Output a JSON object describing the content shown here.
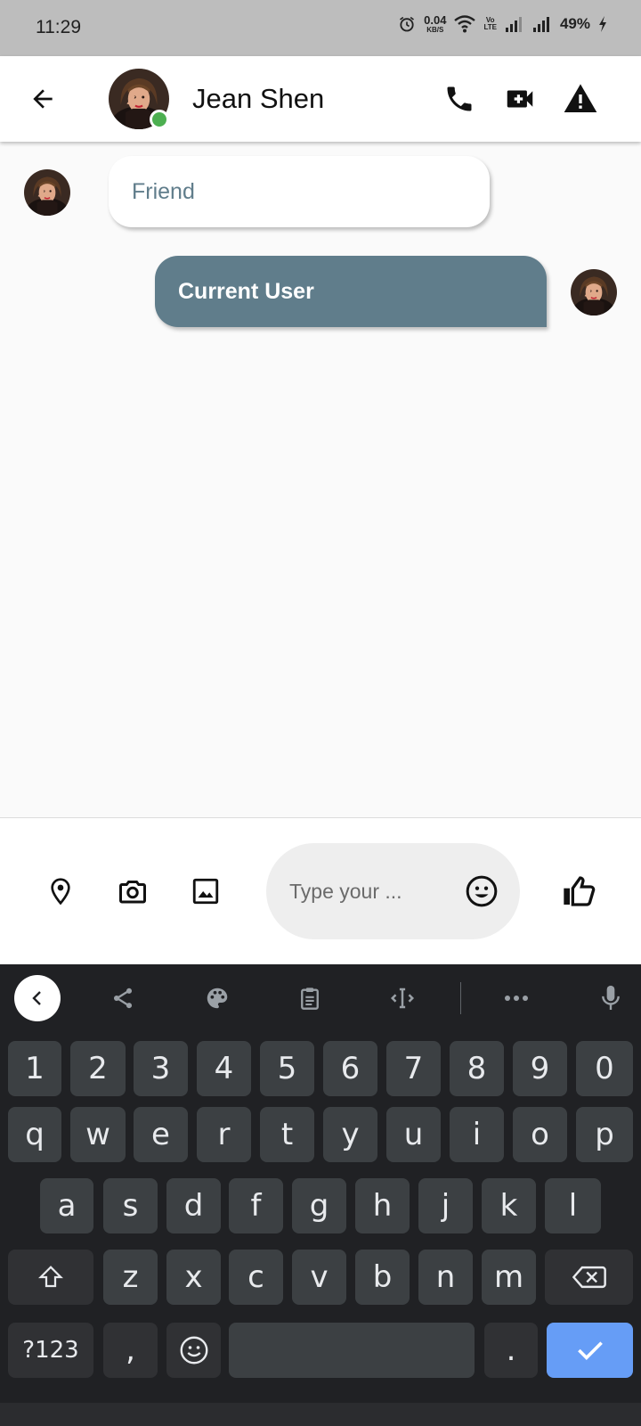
{
  "status_bar": {
    "time": "11:29",
    "net_speed_value": "0.04",
    "net_speed_unit": "KB/S",
    "volte_top": "Vo",
    "volte_bottom": "LTE",
    "battery": "49%"
  },
  "header": {
    "contact_name": "Jean Shen",
    "online_color": "#4caf50"
  },
  "messages": [
    {
      "sender": "friend",
      "text": "Friend"
    },
    {
      "sender": "current_user",
      "text": "Current User"
    }
  ],
  "composer": {
    "placeholder": "Type your ...",
    "icons": [
      "location-icon",
      "camera-icon",
      "image-icon",
      "emoji-icon",
      "thumbs-up-icon"
    ]
  },
  "keyboard": {
    "toolbar_icons": [
      "collapse-icon",
      "share-icon",
      "palette-icon",
      "clipboard-icon",
      "text-cursor-icon",
      "more-icon",
      "mic-icon"
    ],
    "row_numbers": [
      "1",
      "2",
      "3",
      "4",
      "5",
      "6",
      "7",
      "8",
      "9",
      "0"
    ],
    "row_q": [
      "q",
      "w",
      "e",
      "r",
      "t",
      "y",
      "u",
      "i",
      "o",
      "p"
    ],
    "row_a": [
      "a",
      "s",
      "d",
      "f",
      "g",
      "h",
      "j",
      "k",
      "l"
    ],
    "row_z": [
      "z",
      "x",
      "c",
      "v",
      "b",
      "n",
      "m"
    ],
    "symbols_key": "?123",
    "comma_key": ",",
    "period_key": ".",
    "accent_color": "#669df6"
  },
  "colors": {
    "user_bubble": "#607d8b",
    "friend_text": "#607d8b",
    "status_bar": "#bdbdbd",
    "keyboard_bg": "#202124"
  }
}
